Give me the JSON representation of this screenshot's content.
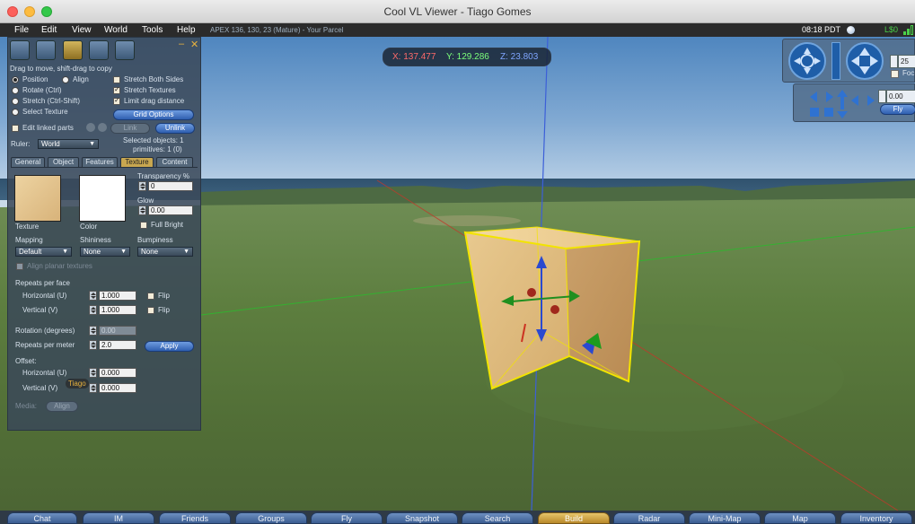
{
  "window": {
    "title": "Cool VL Viewer - Tiago Gomes"
  },
  "menubar": {
    "items": [
      "File",
      "Edit",
      "View",
      "World",
      "Tools",
      "Help"
    ],
    "parcel": "APEX 136, 130, 23 (Mature) - Your Parcel",
    "clock": "08:18 PDT",
    "balance": "L$0"
  },
  "coords": {
    "x": "X: 137.477",
    "y": "Y: 129.286",
    "z": "Z: 23.803"
  },
  "camera": {
    "zoom_value": "25",
    "check_label": "Foc",
    "fly_value": "0.00",
    "fly_label": "Fly"
  },
  "build": {
    "hint": "Drag to move, shift-drag to copy",
    "modes": [
      {
        "label": "Position",
        "on": true
      },
      {
        "label": "Rotate (Ctrl)",
        "on": false
      },
      {
        "label": "Stretch (Ctrl-Shift)",
        "on": false
      },
      {
        "label": "Select Texture",
        "on": false
      }
    ],
    "align_label": "Align",
    "options": [
      {
        "label": "Stretch Both Sides",
        "on": false
      },
      {
        "label": "Stretch Textures",
        "on": true
      },
      {
        "label": "Limit drag distance",
        "on": true
      }
    ],
    "grid_options": "Grid Options",
    "edit_linked": "Edit linked parts",
    "link": "Link",
    "unlink": "Unlink",
    "ruler_label": "Ruler:",
    "ruler_value": "World",
    "selected_objects": "Selected objects: 1",
    "primitives": "primitives: 1 (0)",
    "tabs": [
      "General",
      "Object",
      "Features",
      "Texture",
      "Content"
    ],
    "active_tab": "Texture",
    "texture": {
      "texture_label": "Texture",
      "color_label": "Color",
      "transparency_label": "Transparency %",
      "transparency_value": "0",
      "glow_label": "Glow",
      "glow_value": "0.00",
      "full_bright": "Full Bright",
      "mapping_label": "Mapping",
      "mapping_value": "Default",
      "shininess_label": "Shininess",
      "shininess_value": "None",
      "bumpiness_label": "Bumpiness",
      "bumpiness_value": "None",
      "align_planar": "Align planar textures",
      "repeats_per_face": "Repeats per face",
      "horizontal_label": "Horizontal (U)",
      "horizontal_value": "1.000",
      "vertical_label": "Vertical (V)",
      "vertical_value": "1.000",
      "flip_label": "Flip",
      "rotation_label": "Rotation (degrees)",
      "rotation_value": "0.00",
      "repeats_per_meter_label": "Repeats per meter",
      "repeats_per_meter_value": "2.0",
      "apply": "Apply",
      "offset_label": "Offset:",
      "offset_h_value": "0.000",
      "offset_v_value": "0.000",
      "name_tag": "Tiago",
      "media_label": "Media:",
      "media_align": "Align"
    }
  },
  "toolbar": {
    "buttons": [
      "Chat",
      "IM",
      "Friends",
      "Groups",
      "Fly",
      "Snapshot",
      "Search",
      "Build",
      "Radar",
      "Mini-Map",
      "Map",
      "Inventory"
    ],
    "active": "Build"
  },
  "colors": {
    "selection_outline": "#f2e400",
    "toolbar_active": "#d9b24f",
    "coord_x": "#ff6a6a",
    "coord_y": "#7bff7b",
    "coord_z": "#7fa6ff",
    "balance": "#48d048"
  },
  "icons": [
    "focus-tool-icon",
    "move-tool-icon",
    "edit-tool-icon",
    "create-tool-icon",
    "land-tool-icon",
    "minimize-icon",
    "close-icon",
    "camera-orbit-icon",
    "camera-pan-icon",
    "move-arrows-icon",
    "sun-icon",
    "signal-icon"
  ]
}
